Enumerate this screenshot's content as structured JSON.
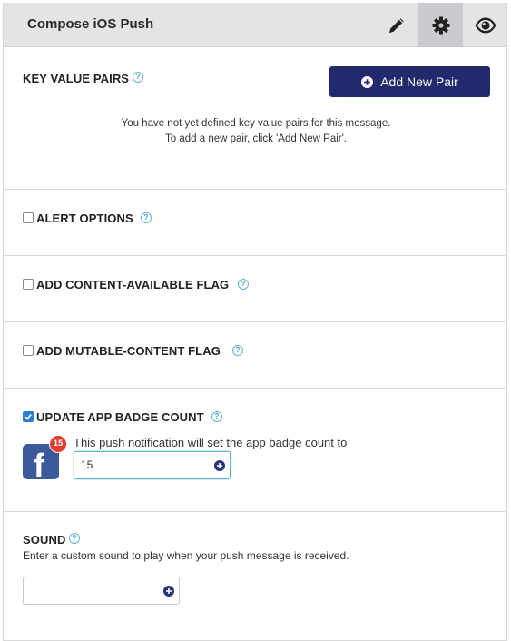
{
  "header": {
    "title": "Compose iOS Push",
    "edit_icon": "pencil-icon",
    "settings_icon": "gear-icon",
    "preview_icon": "eye-icon"
  },
  "key_value_pairs": {
    "title": "KEY VALUE PAIRS",
    "add_button_label": "Add New Pair",
    "empty_line1": "You have not yet defined key value pairs for this message.",
    "empty_line2": "To add a new pair, click 'Add New Pair'."
  },
  "alert_options": {
    "title": "ALERT OPTIONS",
    "checked": false
  },
  "content_available": {
    "title": "ADD CONTENT-AVAILABLE FLAG",
    "checked": false
  },
  "mutable_content": {
    "title": "ADD MUTABLE-CONTENT FLAG",
    "checked": false
  },
  "badge_count": {
    "title": "UPDATE APP BADGE COUNT",
    "checked": true,
    "description": "This push notification will set the app badge count to",
    "value": "15",
    "badge_preview": "15"
  },
  "sound": {
    "title": "SOUND",
    "description": "Enter a custom sound to play when your push message is received.",
    "value": ""
  },
  "help_glyph": "?",
  "colors": {
    "primary_button": "#222a6e",
    "checkbox_checked": "#2a7fd4",
    "badge_red": "#e53b32",
    "facebook_blue": "#3b5a9a"
  }
}
